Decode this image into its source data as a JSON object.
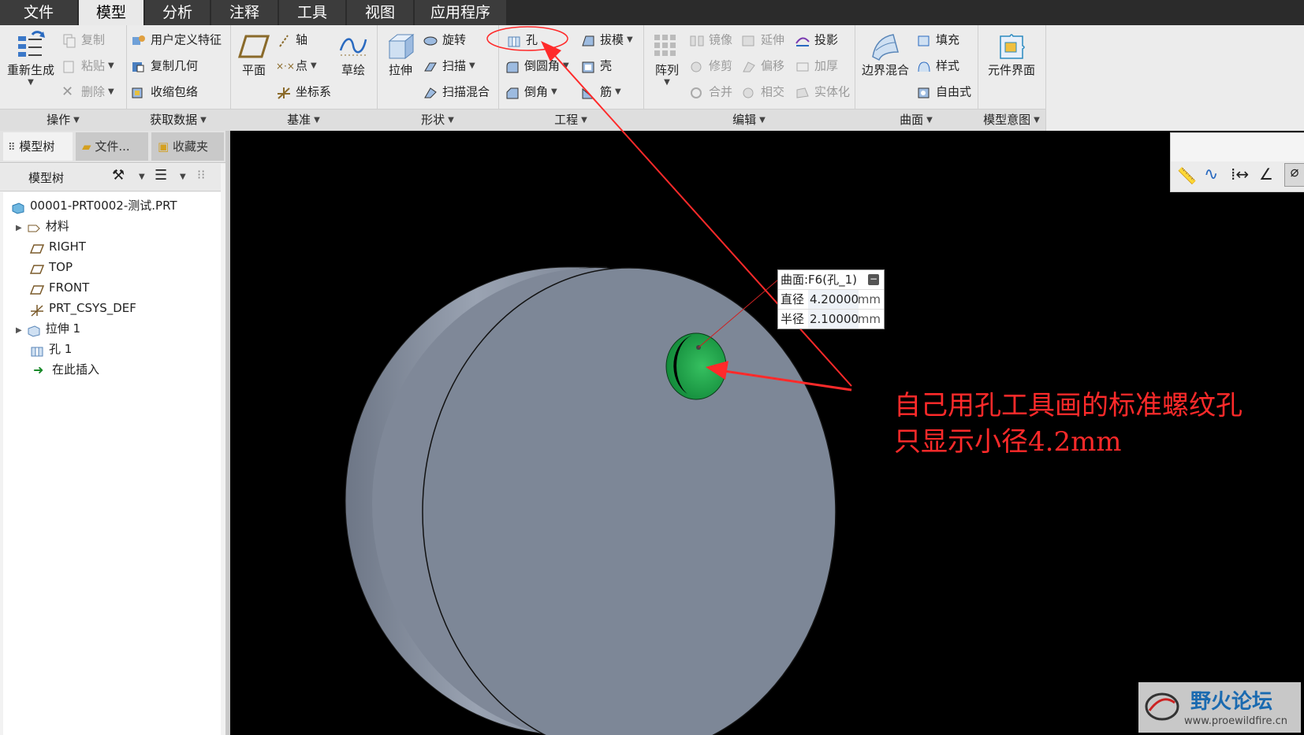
{
  "menu": {
    "tabs": [
      {
        "label": "文件"
      },
      {
        "label": "模型"
      },
      {
        "label": "分析"
      },
      {
        "label": "注释"
      },
      {
        "label": "工具"
      },
      {
        "label": "视图"
      },
      {
        "label": "应用程序"
      }
    ],
    "active": "模型"
  },
  "ribbon": {
    "operations": {
      "regenerate": "重新生成",
      "copy": "复制",
      "paste": "粘贴",
      "delete": "删除",
      "footer": "操作"
    },
    "get_data": {
      "udf": "用户定义特征",
      "copy_geom": "复制几何",
      "shrinkwrap": "收缩包络",
      "footer": "获取数据"
    },
    "datum": {
      "plane": "平面",
      "axis": "轴",
      "point": "点",
      "csys": "坐标系",
      "sketch": "草绘",
      "footer": "基准"
    },
    "shapes": {
      "extrude": "拉伸",
      "revolve": "旋转",
      "sweep": "扫描",
      "swept_blend": "扫描混合",
      "footer": "形状"
    },
    "engineering": {
      "hole": "孔",
      "round": "倒圆角",
      "chamfer": "倒角",
      "draft": "拔模",
      "shell": "壳",
      "rib": "筋",
      "footer": "工程"
    },
    "editing": {
      "pattern": "阵列",
      "mirror": "镜像",
      "extend": "延伸",
      "project": "投影",
      "trim": "修剪",
      "offset": "偏移",
      "thicken": "加厚",
      "merge": "合并",
      "intersect": "相交",
      "solidify": "实体化",
      "footer": "编辑"
    },
    "surfaces": {
      "boundary_blend": "边界混合",
      "fill": "填充",
      "style": "样式",
      "freestyle": "自由式",
      "footer": "曲面"
    },
    "model_intent": {
      "component_interface": "元件界面",
      "footer": "模型意图"
    }
  },
  "left_panel": {
    "tabs": [
      "模型树",
      "文件...",
      "收藏夹"
    ],
    "tree_toolbar_label": "模型树",
    "tree": [
      {
        "label": "00001-PRT0002-测试.PRT"
      },
      {
        "label": "材料"
      },
      {
        "label": "RIGHT"
      },
      {
        "label": "TOP"
      },
      {
        "label": "FRONT"
      },
      {
        "label": "PRT_CSYS_DEF"
      },
      {
        "label": "拉伸 1"
      },
      {
        "label": "孔 1"
      },
      {
        "label": "在此插入"
      }
    ]
  },
  "measure_popup": {
    "title": "曲面:F6(孔_1)",
    "rows": [
      {
        "label": "直径",
        "value": "4.20000",
        "unit": "mm"
      },
      {
        "label": "半径",
        "value": "2.10000",
        "unit": "mm"
      }
    ]
  },
  "annotation": {
    "line1": "自己用孔工具画的标准螺纹孔",
    "line2": "只显示小径4.2mm",
    "color": "#ff2a2a"
  },
  "watermark": {
    "title": "野火论坛",
    "url": "www.proewildfire.cn"
  },
  "colors": {
    "part": "#7d8797",
    "hole": "#1fa64a",
    "ribbon_bg": "#ececec"
  }
}
